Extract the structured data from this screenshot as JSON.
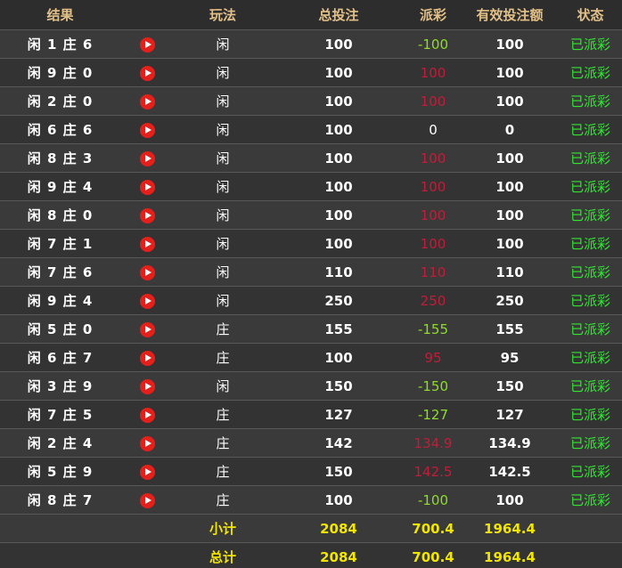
{
  "colors": {
    "header_text": "#e3c088",
    "pay_positive": "#8fdc2a",
    "pay_negative": "#c21c38",
    "status_text": "#2ee82e",
    "summary_text": "#f2e500",
    "play_icon": "#e3201b"
  },
  "headers": {
    "result": "结果",
    "play": "玩法",
    "total_bet": "总投注",
    "payout": "派彩",
    "valid_bet": "有效投注额",
    "status": "状态"
  },
  "rows": [
    {
      "result": "闲 1 庄 6",
      "icon": "play-icon",
      "play": "闲",
      "total_bet": "100",
      "payout": "-100",
      "payout_sign": "pos",
      "valid_bet": "100",
      "status": "已派彩"
    },
    {
      "result": "闲 9 庄 0",
      "icon": "play-icon",
      "play": "闲",
      "total_bet": "100",
      "payout": "100",
      "payout_sign": "neg",
      "valid_bet": "100",
      "status": "已派彩"
    },
    {
      "result": "闲 2 庄 0",
      "icon": "play-icon",
      "play": "闲",
      "total_bet": "100",
      "payout": "100",
      "payout_sign": "neg",
      "valid_bet": "100",
      "status": "已派彩"
    },
    {
      "result": "闲 6 庄 6",
      "icon": "play-icon",
      "play": "闲",
      "total_bet": "100",
      "payout": "0",
      "payout_sign": "zero",
      "valid_bet": "0",
      "status": "已派彩"
    },
    {
      "result": "闲 8 庄 3",
      "icon": "play-icon",
      "play": "闲",
      "total_bet": "100",
      "payout": "100",
      "payout_sign": "neg",
      "valid_bet": "100",
      "status": "已派彩"
    },
    {
      "result": "闲 9 庄 4",
      "icon": "play-icon",
      "play": "闲",
      "total_bet": "100",
      "payout": "100",
      "payout_sign": "neg",
      "valid_bet": "100",
      "status": "已派彩"
    },
    {
      "result": "闲 8 庄 0",
      "icon": "play-icon",
      "play": "闲",
      "total_bet": "100",
      "payout": "100",
      "payout_sign": "neg",
      "valid_bet": "100",
      "status": "已派彩"
    },
    {
      "result": "闲 7 庄 1",
      "icon": "play-icon",
      "play": "闲",
      "total_bet": "100",
      "payout": "100",
      "payout_sign": "neg",
      "valid_bet": "100",
      "status": "已派彩"
    },
    {
      "result": "闲 7 庄 6",
      "icon": "play-icon",
      "play": "闲",
      "total_bet": "110",
      "payout": "110",
      "payout_sign": "neg",
      "valid_bet": "110",
      "status": "已派彩"
    },
    {
      "result": "闲 9 庄 4",
      "icon": "play-icon",
      "play": "闲",
      "total_bet": "250",
      "payout": "250",
      "payout_sign": "neg",
      "valid_bet": "250",
      "status": "已派彩"
    },
    {
      "result": "闲 5 庄 0",
      "icon": "play-icon",
      "play": "庄",
      "total_bet": "155",
      "payout": "-155",
      "payout_sign": "pos",
      "valid_bet": "155",
      "status": "已派彩"
    },
    {
      "result": "闲 6 庄 7",
      "icon": "play-icon",
      "play": "庄",
      "total_bet": "100",
      "payout": "95",
      "payout_sign": "neg",
      "valid_bet": "95",
      "status": "已派彩"
    },
    {
      "result": "闲 3 庄 9",
      "icon": "play-icon",
      "play": "闲",
      "total_bet": "150",
      "payout": "-150",
      "payout_sign": "pos",
      "valid_bet": "150",
      "status": "已派彩"
    },
    {
      "result": "闲 7 庄 5",
      "icon": "play-icon",
      "play": "庄",
      "total_bet": "127",
      "payout": "-127",
      "payout_sign": "pos",
      "valid_bet": "127",
      "status": "已派彩"
    },
    {
      "result": "闲 2 庄 4",
      "icon": "play-icon",
      "play": "庄",
      "total_bet": "142",
      "payout": "134.9",
      "payout_sign": "neg",
      "valid_bet": "134.9",
      "status": "已派彩"
    },
    {
      "result": "闲 5 庄 9",
      "icon": "play-icon",
      "play": "庄",
      "total_bet": "150",
      "payout": "142.5",
      "payout_sign": "neg",
      "valid_bet": "142.5",
      "status": "已派彩"
    },
    {
      "result": "闲 8 庄 7",
      "icon": "play-icon",
      "play": "庄",
      "total_bet": "100",
      "payout": "-100",
      "payout_sign": "pos",
      "valid_bet": "100",
      "status": "已派彩"
    }
  ],
  "subtotal": {
    "label": "小计",
    "total_bet": "2084",
    "payout": "700.4",
    "valid_bet": "1964.4"
  },
  "total": {
    "label": "总计",
    "total_bet": "2084",
    "payout": "700.4",
    "valid_bet": "1964.4"
  }
}
